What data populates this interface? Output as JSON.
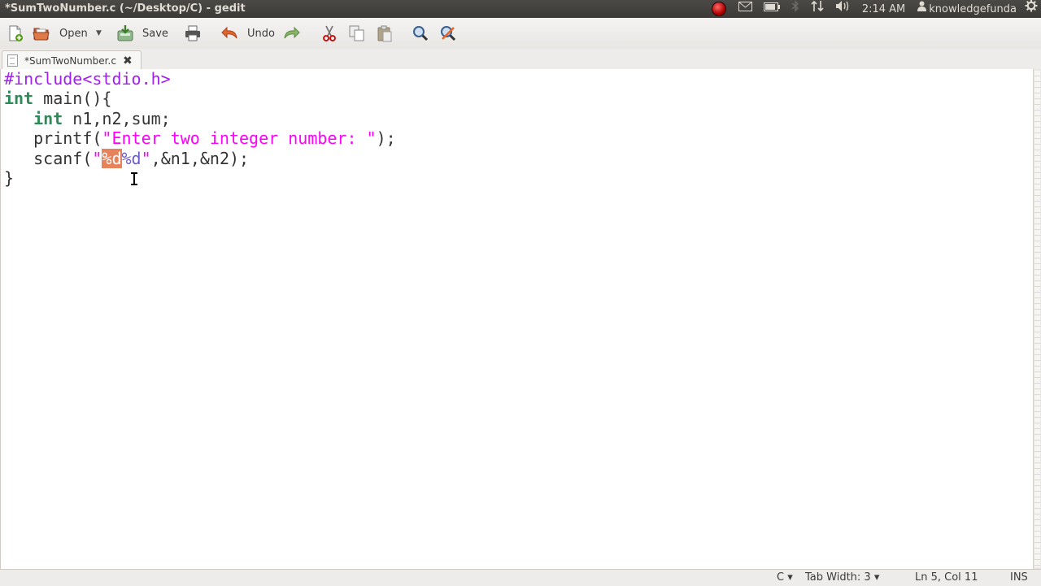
{
  "window": {
    "title": "*SumTwoNumber.c (~/Desktop/C) - gedit"
  },
  "tray": {
    "clock": "2:14 AM",
    "user": "knowledgefunda"
  },
  "toolbar": {
    "open_label": "Open",
    "save_label": "Save",
    "undo_label": "Undo"
  },
  "tab": {
    "label": "*SumTwoNumber.c",
    "close_glyph": "✖"
  },
  "code": {
    "l1": "#include<stdio.h>",
    "l2_kw": "int",
    "l2_rest": " main(){",
    "l3_indent": "   ",
    "l3_kw": "int",
    "l3_rest": " n1,n2,sum;",
    "l4_a": "   printf(",
    "l4_str": "\"Enter two integer number: \"",
    "l4_b": ");",
    "l5_a": "   scanf(",
    "l5_q1": "\"",
    "l5_sel": "%d",
    "l5_fmt": "%d",
    "l5_q2": "\"",
    "l5_b": ",&n1,&n2);",
    "l6": "}"
  },
  "status": {
    "language": "C ▾",
    "tab_width": "Tab Width: 3 ▾",
    "position": "Ln 5, Col 11",
    "mode": "INS"
  },
  "colors": {
    "preprocessor": "#a020f0",
    "keyword": "#2e8b57",
    "string": "#ff00ff",
    "format": "#6a5acd",
    "selection": "#e8825a"
  },
  "icons": [
    "new-document-icon",
    "open-folder-icon",
    "dropdown-arrow-icon",
    "save-icon",
    "print-icon",
    "undo-icon",
    "redo-icon",
    "cut-icon",
    "copy-icon",
    "paste-icon",
    "search-icon",
    "replace-icon",
    "record-icon",
    "mail-icon",
    "battery-icon",
    "bluetooth-icon",
    "network-icon",
    "volume-icon",
    "user-icon",
    "settings-gear-icon"
  ]
}
